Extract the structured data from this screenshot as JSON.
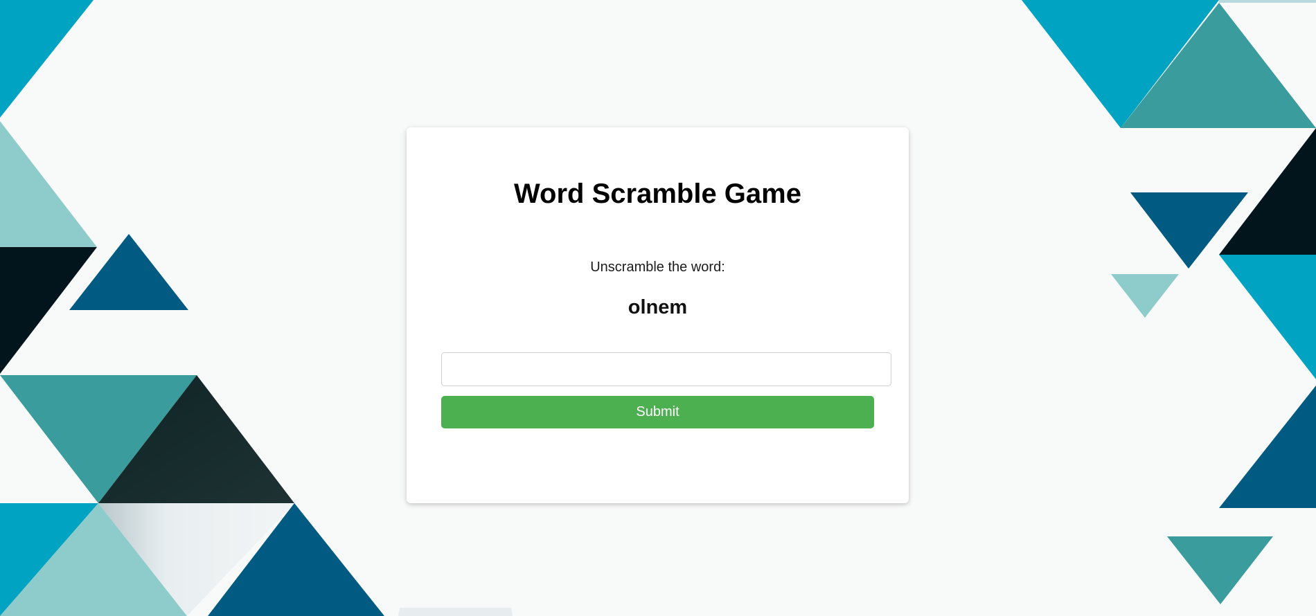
{
  "game": {
    "title": "Word Scramble Game",
    "prompt": "Unscramble the word:",
    "scrambled_word": "olnem"
  },
  "form": {
    "answer_value": "",
    "submit_label": "Submit"
  },
  "colors": {
    "background": "#f8f9f9",
    "card": "#ffffff",
    "submit_button": "#4caf50",
    "triangle_teal": "#3a9c9c",
    "triangle_cyan": "#00a4c2",
    "triangle_navy": "#005a82",
    "triangle_dark": "#02151c",
    "triangle_light": "#8ecbcb"
  }
}
